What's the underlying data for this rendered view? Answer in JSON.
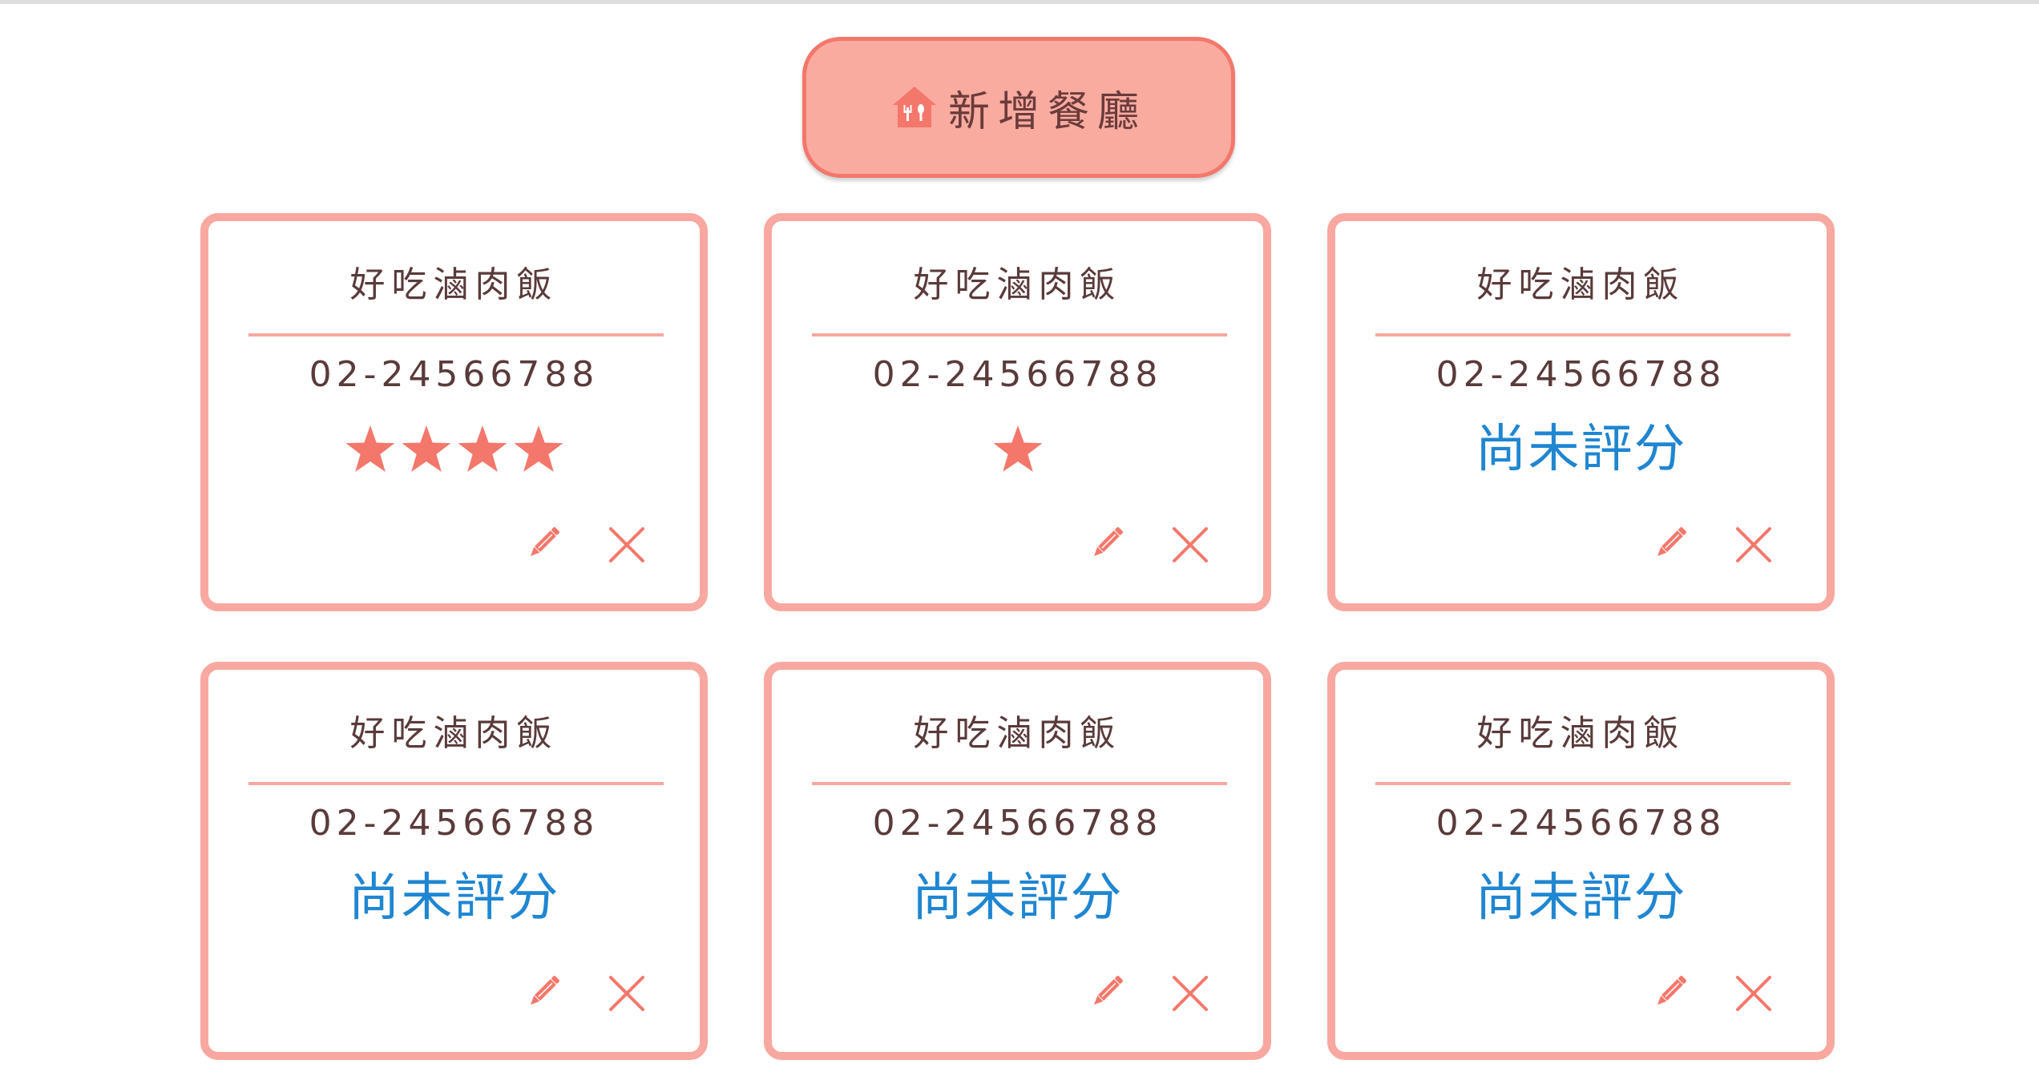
{
  "add_button": {
    "label": "新增餐廳",
    "icon": "house-utensils-icon"
  },
  "colors": {
    "accent": "#f4776b",
    "card_border": "#f8a8a0",
    "button_fill": "#f9aba0",
    "text": "#5a3a3a",
    "unrated": "#1f86d2"
  },
  "unrated_label": "尚未評分",
  "restaurants": [
    {
      "name": "好吃滷肉飯",
      "phone": "02-24566788",
      "rating": 4
    },
    {
      "name": "好吃滷肉飯",
      "phone": "02-24566788",
      "rating": 1
    },
    {
      "name": "好吃滷肉飯",
      "phone": "02-24566788",
      "rating": 0
    },
    {
      "name": "好吃滷肉飯",
      "phone": "02-24566788",
      "rating": 0
    },
    {
      "name": "好吃滷肉飯",
      "phone": "02-24566788",
      "rating": 0
    },
    {
      "name": "好吃滷肉飯",
      "phone": "02-24566788",
      "rating": 0
    }
  ],
  "card_actions": {
    "edit_icon": "pencil-icon",
    "delete_icon": "close-icon"
  }
}
